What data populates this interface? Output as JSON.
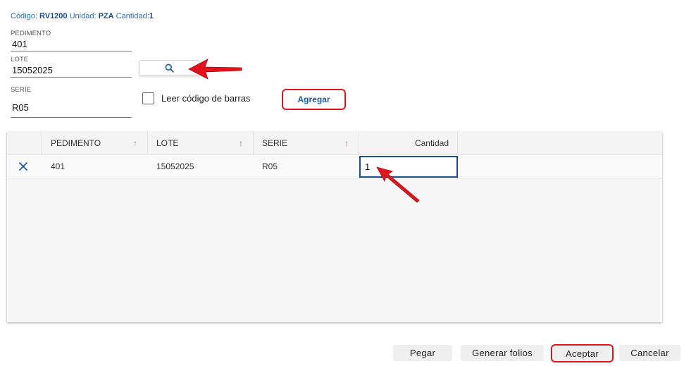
{
  "header": {
    "codigo_label": "Código:",
    "codigo_value": "RV1200",
    "unidad_label": "Unidad:",
    "unidad_value": "PZA",
    "cantidad_label": "Cantidad:",
    "cantidad_value": "1"
  },
  "form": {
    "pedimento": {
      "label": "PEDIMENTO",
      "value": "401"
    },
    "lote": {
      "label": "LOTE",
      "value": "15052025"
    },
    "serie": {
      "label": "SERIE",
      "value": "R05"
    },
    "search_icon": "search-icon",
    "barcode_checkbox_label": "Leer código de barras",
    "barcode_checked": false,
    "add_button_label": "Agregar"
  },
  "grid": {
    "columns": [
      {
        "label": "PEDIMENTO",
        "sort_icon": "arrow-up-icon"
      },
      {
        "label": "LOTE",
        "sort_icon": "arrow-up-icon"
      },
      {
        "label": "SERIE",
        "sort_icon": "arrow-up-icon"
      },
      {
        "label": "Cantidad"
      }
    ],
    "rows": [
      {
        "pedimento": "401",
        "lote": "15052025",
        "serie": "R05",
        "cantidad": "1",
        "delete_icon": "close-icon"
      }
    ]
  },
  "footer": {
    "pegar_label": "Pegar",
    "generar_label": "Generar folios",
    "aceptar_label": "Aceptar",
    "cancelar_label": "Cancelar"
  },
  "colors": {
    "accent_blue": "#1b5aa6",
    "highlight_red": "#e0151b",
    "focus_border": "#1e4f8f"
  }
}
